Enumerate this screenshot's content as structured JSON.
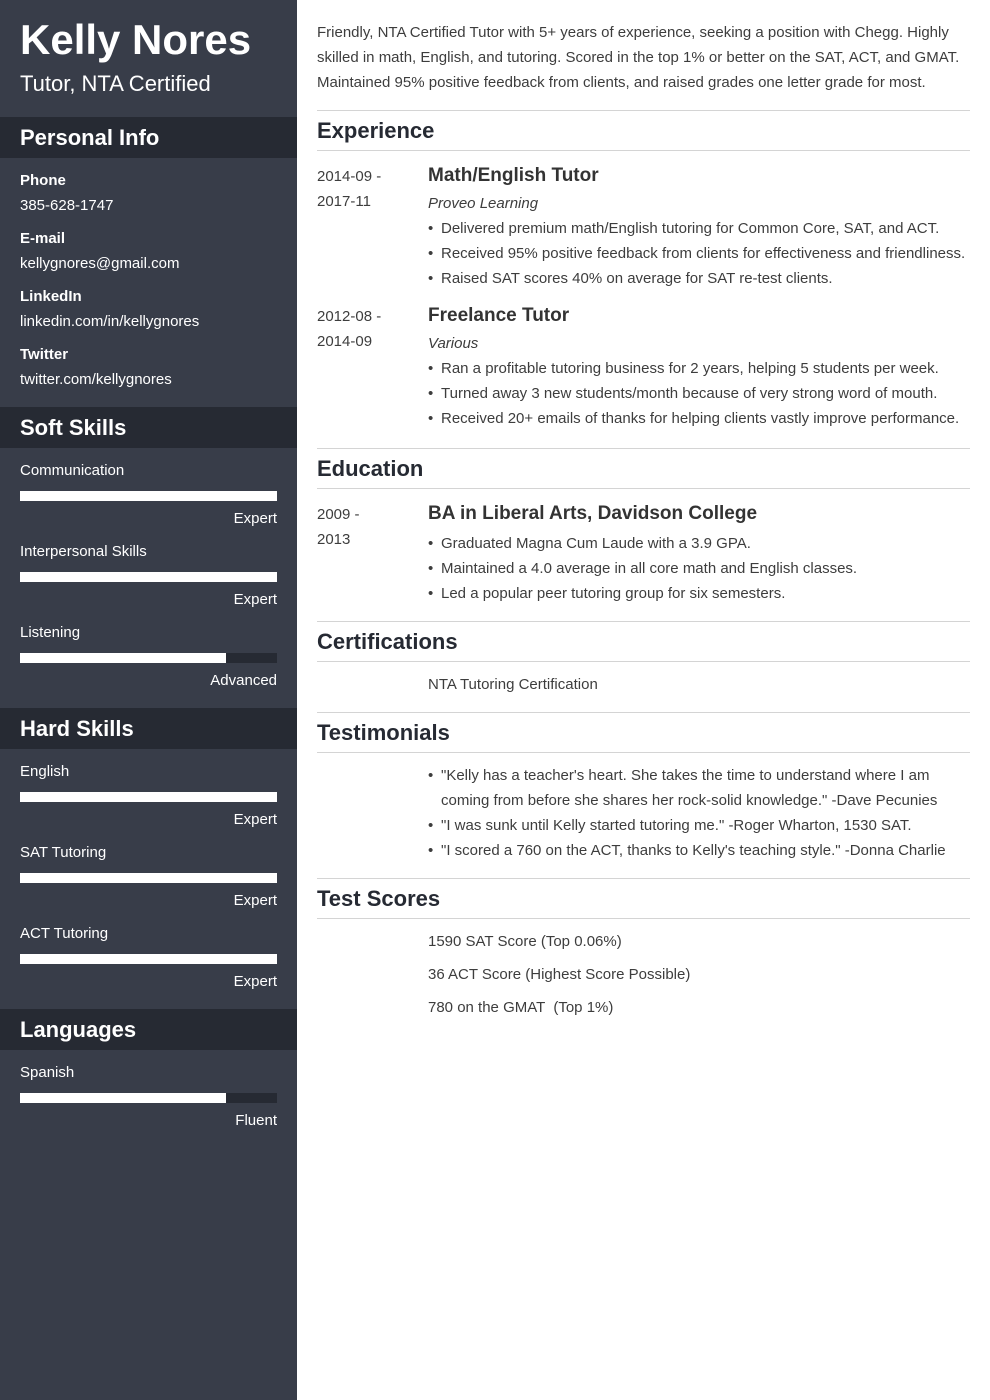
{
  "header": {
    "name": "Kelly Nores",
    "title": "Tutor, NTA Certified"
  },
  "sidebar": {
    "personal_info": {
      "heading": "Personal Info",
      "items": [
        {
          "label": "Phone",
          "value": "385-628-1747"
        },
        {
          "label": "E-mail",
          "value": "kellygnores@gmail.com"
        },
        {
          "label": "LinkedIn",
          "value": "linkedin.com/in/kellygnores"
        },
        {
          "label": "Twitter",
          "value": "twitter.com/kellygnores"
        }
      ]
    },
    "soft_skills": {
      "heading": "Soft Skills",
      "items": [
        {
          "name": "Communication",
          "level": "Expert",
          "fraction": 1.0
        },
        {
          "name": "Interpersonal Skills",
          "level": "Expert",
          "fraction": 1.0
        },
        {
          "name": "Listening",
          "level": "Advanced",
          "fraction": 0.8
        }
      ]
    },
    "hard_skills": {
      "heading": "Hard Skills",
      "items": [
        {
          "name": "English",
          "level": "Expert",
          "fraction": 1.0
        },
        {
          "name": "SAT Tutoring",
          "level": "Expert",
          "fraction": 1.0
        },
        {
          "name": "ACT Tutoring",
          "level": "Expert",
          "fraction": 1.0
        }
      ]
    },
    "languages": {
      "heading": "Languages",
      "items": [
        {
          "name": "Spanish",
          "level": "Fluent",
          "fraction": 0.8
        }
      ]
    }
  },
  "main": {
    "summary": "Friendly, NTA Certified Tutor with 5+ years of experience, seeking a position with Chegg. Highly skilled in math, English, and tutoring. Scored in the top 1% or better on the SAT, ACT, and GMAT. Maintained 95% positive feedback from clients, and raised grades one letter grade for most.",
    "experience": {
      "heading": "Experience",
      "items": [
        {
          "date_start": "2014-09 -",
          "date_end": "2017-11",
          "title": "Math/English Tutor",
          "org": "Proveo Learning",
          "bullets": [
            "Delivered premium math/English tutoring for Common Core, SAT, and ACT.",
            "Received 95% positive feedback from clients for effectiveness and friendliness.",
            "Raised SAT scores 40% on average for SAT re-test clients."
          ]
        },
        {
          "date_start": "2012-08 -",
          "date_end": "2014-09",
          "title": "Freelance Tutor",
          "org": "Various",
          "bullets": [
            "Ran a profitable tutoring business for 2 years, helping 5 students per week.",
            "Turned away 3 new students/month because of very strong word of mouth.",
            "Received 20+ emails of thanks for helping clients vastly improve performance."
          ]
        }
      ]
    },
    "education": {
      "heading": "Education",
      "items": [
        {
          "date_start": "2009 -",
          "date_end": "2013",
          "title": "BA in Liberal Arts, Davidson College",
          "bullets": [
            "Graduated Magna Cum Laude with a 3.9 GPA.",
            "Maintained a 4.0 average in all core math and English classes.",
            "Led a popular peer tutoring group for six semesters."
          ]
        }
      ]
    },
    "certifications": {
      "heading": "Certifications",
      "items": [
        "NTA Tutoring Certification"
      ]
    },
    "testimonials": {
      "heading": "Testimonials",
      "items": [
        "\"Kelly has a teacher's heart. She takes the time to understand where I am coming from before she shares her rock-solid knowledge.\" -Dave Pecunies",
        "\"I was sunk until Kelly started tutoring me.\" -Roger Wharton, 1530 SAT.",
        "\"I scored a 760 on the ACT, thanks to Kelly's teaching style.\" -Donna Charlie"
      ]
    },
    "test_scores": {
      "heading": "Test Scores",
      "items": [
        "1590 SAT Score (Top 0.06%)",
        "36 ACT Score (Highest Score Possible)",
        "780 on the GMAT  (Top 1%)"
      ]
    }
  }
}
